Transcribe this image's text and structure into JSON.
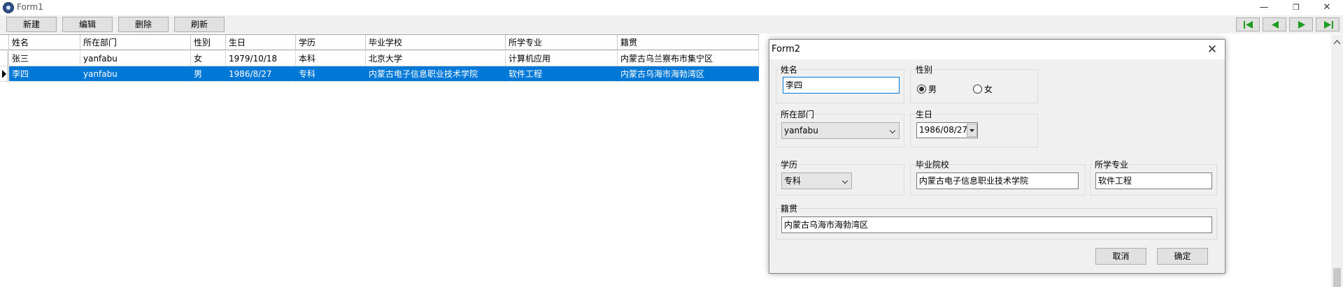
{
  "window": {
    "title": "Form1",
    "controls": {
      "minimize": "—",
      "restore": "❐",
      "close": "✕"
    }
  },
  "toolbar": {
    "new_label": "新建",
    "edit_label": "编辑",
    "delete_label": "删除",
    "refresh_label": "刷新",
    "nav": [
      "first-record-icon",
      "prev-record-icon",
      "next-record-icon",
      "last-record-icon"
    ],
    "nav_color": "#1e9e1e"
  },
  "grid": {
    "columns": [
      "姓名",
      "所在部门",
      "性别",
      "生日",
      "学历",
      "毕业学校",
      "所学专业",
      "籍贯"
    ],
    "rows": [
      [
        "张三",
        "yanfabu",
        "女",
        "1979/10/18",
        "本科",
        "北京大学",
        "计算机应用",
        "内蒙古乌兰察布市集宁区"
      ],
      [
        "李四",
        "yanfabu",
        "男",
        "1986/8/27",
        "专科",
        "内蒙古电子信息职业技术学院",
        "软件工程",
        "内蒙古乌海市海勃湾区"
      ]
    ],
    "selected_row": 1,
    "selection_color": "#0078d7"
  },
  "dialog": {
    "title": "Form2",
    "name_label": "姓名",
    "name_value": "李四",
    "gender_label": "性别",
    "gender_male": "男",
    "gender_female": "女",
    "gender_selected": "男",
    "dept_label": "所在部门",
    "dept_value": "yanfabu",
    "birthday_label": "生日",
    "birthday_value": "1986/08/27",
    "education_label": "学历",
    "education_value": "专科",
    "school_label": "毕业院校",
    "school_value": "内蒙古电子信息职业技术学院",
    "major_label": "所学专业",
    "major_value": "软件工程",
    "hometown_label": "籍贯",
    "hometown_value": "内蒙古乌海市海勃湾区",
    "cancel_label": "取消",
    "ok_label": "确定"
  }
}
